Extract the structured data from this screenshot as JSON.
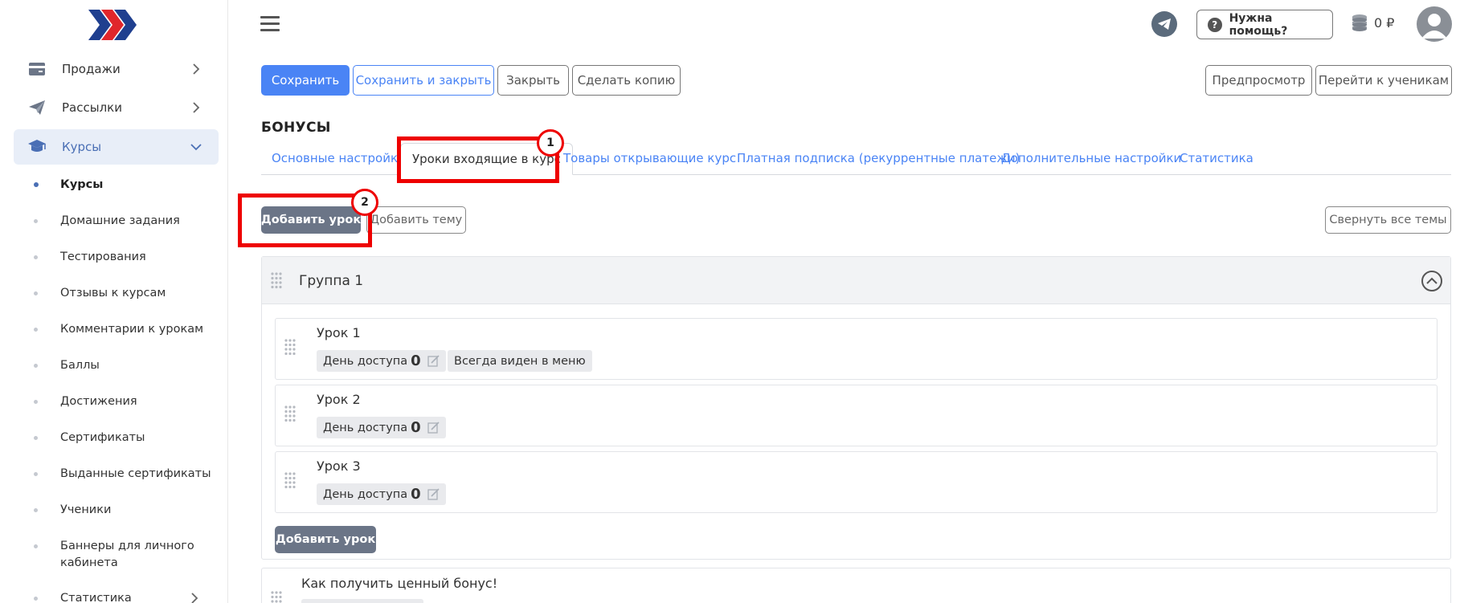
{
  "sidebar": {
    "items": [
      {
        "label": "Продажи",
        "icon": "wallet-icon"
      },
      {
        "label": "Рассылки",
        "icon": "paper-plane-icon"
      },
      {
        "label": "Курсы",
        "icon": "graduation-cap-icon"
      }
    ],
    "sub_items": [
      {
        "label": "Курсы"
      },
      {
        "label": "Домашние задания"
      },
      {
        "label": "Тестирования"
      },
      {
        "label": "Отзывы к курсам"
      },
      {
        "label": "Комментарии к урокам"
      },
      {
        "label": "Баллы"
      },
      {
        "label": "Достижения"
      },
      {
        "label": "Сертификаты"
      },
      {
        "label": "Выданные сертификаты"
      },
      {
        "label": "Ученики"
      },
      {
        "label": "Баннеры для личного кабинета"
      }
    ],
    "bottom_item": {
      "label": "Статистика"
    }
  },
  "header": {
    "help_label": "Нужна помощь?",
    "help_icon_glyph": "?",
    "balance": "0 ₽"
  },
  "toolbar": {
    "save": "Сохранить",
    "save_close": "Сохранить и закрыть",
    "close": "Закрыть",
    "copy": "Сделать копию",
    "preview": "Предпросмотр",
    "students": "Перейти к ученикам"
  },
  "section_title": "БОНУСЫ",
  "tabs": [
    {
      "label": "Основные настройки"
    },
    {
      "label": "Уроки входящие в курс"
    },
    {
      "label": "Товары открывающие курс"
    },
    {
      "label": "Платная подписка (рекуррентные платежи)"
    },
    {
      "label": "Дополнительные настройки"
    },
    {
      "label": "Статистика"
    }
  ],
  "callouts": [
    "1",
    "2"
  ],
  "actions": {
    "add_lesson": "Добавить урок",
    "add_topic": "Добавить тему",
    "collapse_all": "Свернуть все темы"
  },
  "group": {
    "title": "Группа 1",
    "lessons": [
      {
        "title": "Урок 1",
        "access_label": "День доступа",
        "access_value": "0",
        "badge": "Всегда виден в меню"
      },
      {
        "title": "Урок 2",
        "access_label": "День доступа",
        "access_value": "0"
      },
      {
        "title": "Урок 3",
        "access_label": "День доступа",
        "access_value": "0"
      }
    ],
    "add_lesson": "Добавить урок"
  },
  "bonus": {
    "title": "Как получить ценный бонус!"
  },
  "colors": {
    "primary": "#4a84f5",
    "callout": "#ee0000",
    "sidebar_active_bg": "#e8eef8"
  }
}
